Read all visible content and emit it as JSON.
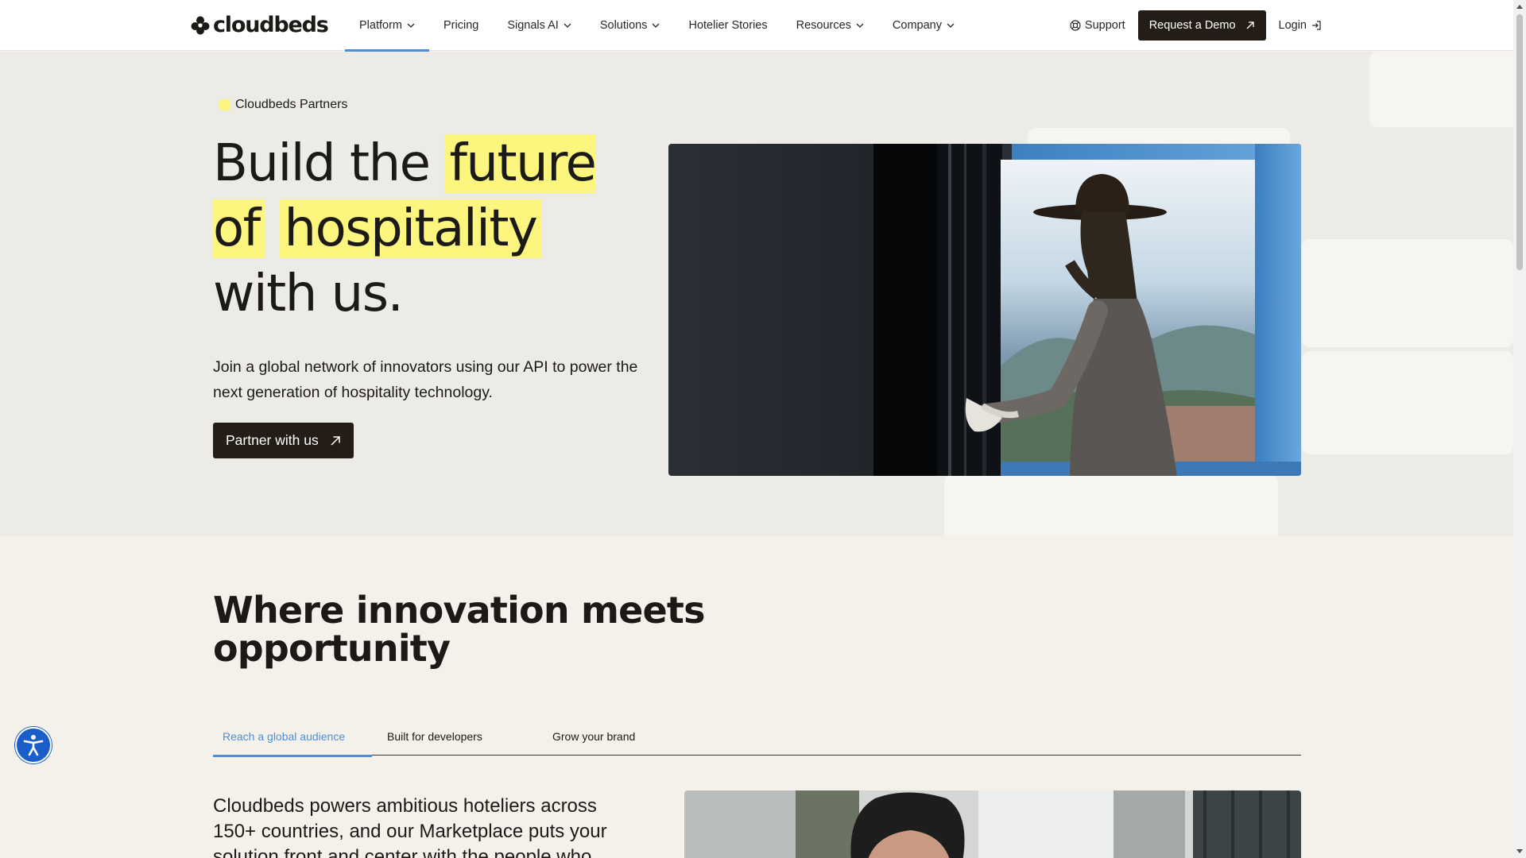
{
  "nav": {
    "logo_text": "cloudbeds",
    "items": [
      {
        "label": "Platform",
        "has_dropdown": true,
        "active": true
      },
      {
        "label": "Pricing",
        "has_dropdown": false
      },
      {
        "label": "Signals AI",
        "has_dropdown": true
      },
      {
        "label": "Solutions",
        "has_dropdown": true
      },
      {
        "label": "Hotelier Stories",
        "has_dropdown": false
      },
      {
        "label": "Resources",
        "has_dropdown": true
      },
      {
        "label": "Company",
        "has_dropdown": true
      }
    ],
    "support_label": "Support",
    "demo_label": "Request a Demo",
    "login_label": "Login"
  },
  "hero": {
    "eyebrow": "Cloudbeds Partners",
    "title_part1": "Build the ",
    "title_highlight1": "future of",
    "title_highlight2": "hospitality",
    "title_part2": " with us.",
    "description": "Join a global network of innovators using our API to power the next generation of hospitality technology.",
    "cta_label": "Partner with us"
  },
  "section": {
    "title": "Where innovation meets opportunity",
    "tabs": [
      {
        "label": "Reach a global audience",
        "active": true
      },
      {
        "label": "Built for developers",
        "active": false
      },
      {
        "label": "Grow your brand",
        "active": false
      }
    ],
    "body": "Cloudbeds powers ambitious hoteliers across 150+ countries, and our Marketplace puts your solution front and center with the people who"
  },
  "colors": {
    "accent_blue": "#4d8fd6",
    "highlight_yellow": "#fcf67e",
    "button_dark": "#231d16",
    "accessibility_blue": "#1b5ec9"
  }
}
